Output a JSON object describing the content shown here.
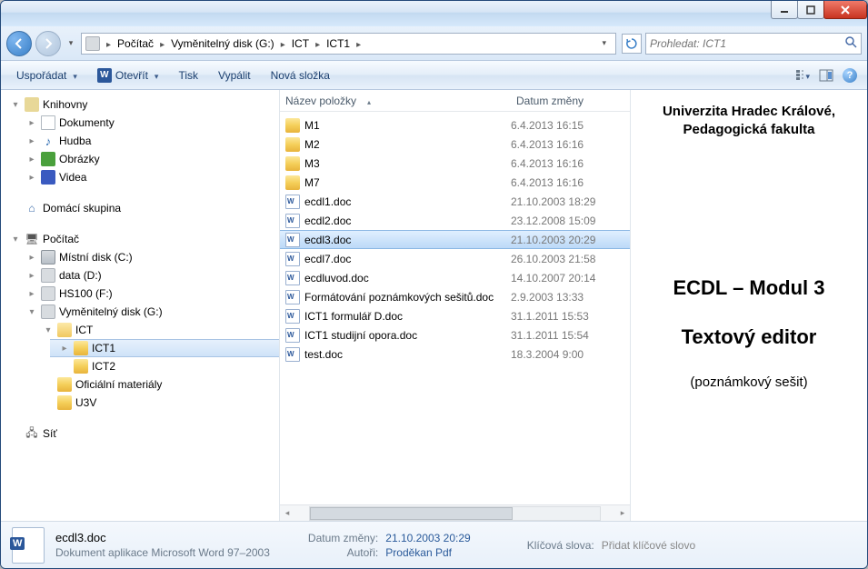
{
  "titlebar": {},
  "breadcrumb": {
    "root": "Počítač",
    "p1": "Vyměnitelný disk (G:)",
    "p2": "ICT",
    "p3": "ICT1"
  },
  "search": {
    "placeholder": "Prohledat: ICT1"
  },
  "toolbar": {
    "organize": "Uspořádat",
    "open": "Otevřít",
    "print": "Tisk",
    "burn": "Vypálit",
    "newfolder": "Nová složka"
  },
  "tree": {
    "libraries": "Knihovny",
    "documents": "Dokumenty",
    "music": "Hudba",
    "pictures": "Obrázky",
    "videos": "Videa",
    "homegroup": "Domácí skupina",
    "computer": "Počítač",
    "drive_c": "Místní disk (C:)",
    "drive_d": "data (D:)",
    "drive_f": "HS100 (F:)",
    "drive_g": "Vyměnitelný disk (G:)",
    "ict": "ICT",
    "ict1": "ICT1",
    "ict2": "ICT2",
    "ofic": "Oficiální materiály",
    "u3v": "U3V",
    "network": "Síť"
  },
  "columns": {
    "name": "Název položky",
    "date": "Datum změny"
  },
  "files": [
    {
      "name": "M1",
      "date": "6.4.2013 16:15",
      "kind": "folder"
    },
    {
      "name": "M2",
      "date": "6.4.2013 16:16",
      "kind": "folder"
    },
    {
      "name": "M3",
      "date": "6.4.2013 16:16",
      "kind": "folder"
    },
    {
      "name": "M7",
      "date": "6.4.2013 16:16",
      "kind": "folder"
    },
    {
      "name": "ecdl1.doc",
      "date": "21.10.2003 18:29",
      "kind": "word"
    },
    {
      "name": "ecdl2.doc",
      "date": "23.12.2008 15:09",
      "kind": "word"
    },
    {
      "name": "ecdl3.doc",
      "date": "21.10.2003 20:29",
      "kind": "word",
      "selected": true
    },
    {
      "name": "ecdl7.doc",
      "date": "26.10.2003 21:58",
      "kind": "word"
    },
    {
      "name": "ecdluvod.doc",
      "date": "14.10.2007 20:14",
      "kind": "word"
    },
    {
      "name": "Formátování poznámkových sešitů.doc",
      "date": "2.9.2003 13:33",
      "kind": "word"
    },
    {
      "name": "ICT1 formulář D.doc",
      "date": "31.1.2011 15:53",
      "kind": "word"
    },
    {
      "name": "ICT1 studijní opora.doc",
      "date": "31.1.2011 15:54",
      "kind": "word"
    },
    {
      "name": "test.doc",
      "date": "18.3.2004 9:00",
      "kind": "word"
    }
  ],
  "preview": {
    "uni1": "Univerzita Hradec Králové,",
    "uni2": "Pedagogická fakulta",
    "title": "ECDL – Modul 3",
    "sub": "Textový editor",
    "note": "(poznámkový sešit)"
  },
  "details": {
    "filename": "ecdl3.doc",
    "filetype": "Dokument aplikace Microsoft Word 97–2003",
    "date_label": "Datum změny:",
    "date_value": "21.10.2003 20:29",
    "author_label": "Autoři:",
    "author_value": "Proděkan Pdf",
    "keywords_label": "Klíčová slova:",
    "keywords_value": "Přidat klíčové slovo"
  }
}
